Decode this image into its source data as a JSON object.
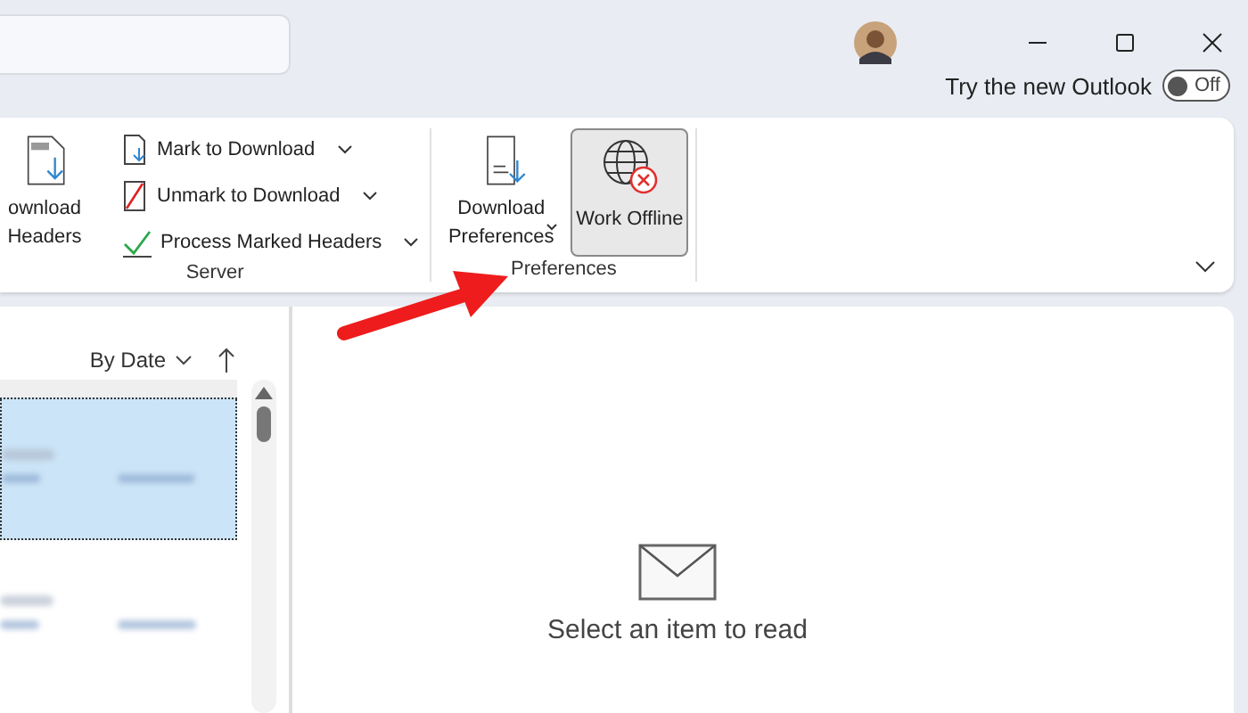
{
  "title_bar": {
    "new_outlook": {
      "label": "Try the new Outlook",
      "toggle_text": "Off",
      "on": false
    }
  },
  "ribbon": {
    "groups": [
      {
        "name": "Server",
        "large_button": {
          "label": "ownload Headers"
        },
        "items": [
          {
            "label": "Mark to Download",
            "kind": "mark"
          },
          {
            "label": "Unmark to Download",
            "kind": "unmark"
          },
          {
            "label": "Process Marked Headers",
            "kind": "process"
          }
        ]
      },
      {
        "name": "Preferences",
        "buttons": [
          {
            "label": "Download Preferences",
            "kind": "download",
            "selected": false,
            "dropdown": true
          },
          {
            "label": "Work Offline",
            "kind": "offline",
            "selected": true,
            "dropdown": false
          }
        ]
      }
    ]
  },
  "message_list": {
    "sort": "By Date",
    "rows": [
      {
        "selected": true
      },
      {
        "selected": false
      }
    ]
  },
  "reading_pane": {
    "message": "Select an item to read"
  }
}
